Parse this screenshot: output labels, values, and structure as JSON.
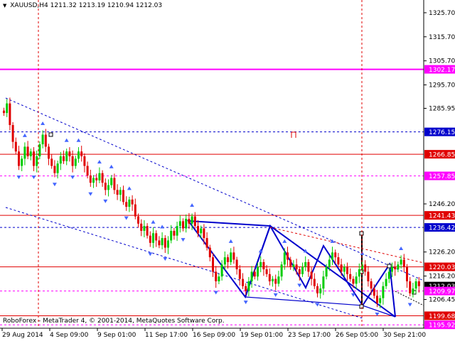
{
  "header": {
    "symbol": "XAUUSD,H4",
    "open": "1211.32",
    "high": "1213.19",
    "low": "1210.94",
    "close": "1212.03"
  },
  "copyright": "RoboForex - MetaTrader 4, © 2001-2014, MetaQuotes Software Corp.",
  "colors": {
    "bull_candle": "#00cc00",
    "bear_candle": "#e00000",
    "pivot_line": "#ff00ff",
    "level_line": "#e00000",
    "channel": "#0000cc",
    "accent_label": "#e00000"
  },
  "icons": {
    "symbol_arrow": "triangle-down-icon",
    "alert": "alert-marker-icon"
  },
  "chart_data": {
    "type": "candlestick",
    "symbol": "XAUUSD",
    "timeframe": "H4",
    "ylim": [
      1194.5,
      1331.0
    ],
    "y_ticks": [
      "1325.70",
      "1315.70",
      "1305.70",
      "1295.70",
      "1285.95",
      "1246.20",
      "1226.20",
      "1216.20",
      "1206.45"
    ],
    "x_ticks": [
      "29 Aug 2014",
      "4 Sep 09:00",
      "9 Sep 01:00",
      "11 Sep 17:00",
      "16 Sep 09:00",
      "19 Sep 01:00",
      "23 Sep 17:00",
      "26 Sep 05:00",
      "30 Sep 21:00"
    ],
    "price_levels": [
      {
        "price": 1302.17,
        "label": "1302.17",
        "color": "#ff00ff",
        "style": "solid"
      },
      {
        "price": 1276.15,
        "label": "1276.15",
        "color": "#0000cc",
        "style": "dashed"
      },
      {
        "price": 1266.85,
        "label": "1266.85",
        "color": "#e00000",
        "style": "solid"
      },
      {
        "price": 1257.85,
        "label": "1257.85",
        "color": "#ff00ff",
        "style": "dashed"
      },
      {
        "price": 1241.43,
        "label": "1241.43",
        "color": "#e00000",
        "style": "solid"
      },
      {
        "price": 1236.42,
        "label": "1236.42",
        "color": "#0000cc",
        "style": "dashed"
      },
      {
        "price": 1220.03,
        "label": "1220.03",
        "color": "#e00000",
        "style": "solid"
      },
      {
        "price": 1212.03,
        "label": "1212.03",
        "color": "#000000",
        "style": "current"
      },
      {
        "price": 1209.97,
        "label": "1209.97",
        "color": "#ff00ff",
        "style": "dashed"
      },
      {
        "price": 1199.68,
        "label": "1199.68",
        "color": "#e00000",
        "style": "solid"
      },
      {
        "price": 1195.92,
        "label": "1195.92",
        "color": "#ff00ff",
        "style": "dashed"
      }
    ],
    "closes": [
      1284,
      1288,
      1279,
      1272,
      1268,
      1262,
      1265,
      1270,
      1266,
      1268,
      1262,
      1266,
      1271,
      1275,
      1270,
      1265,
      1262,
      1259,
      1263,
      1266,
      1264,
      1268,
      1266,
      1262,
      1265,
      1268,
      1266,
      1262,
      1258,
      1255,
      1257,
      1256,
      1259,
      1255,
      1252,
      1254,
      1257,
      1252,
      1250,
      1252,
      1247,
      1245,
      1248,
      1246,
      1241,
      1238,
      1235,
      1237,
      1233,
      1230,
      1234,
      1231,
      1229,
      1232,
      1228,
      1231,
      1235,
      1233,
      1237,
      1239,
      1236,
      1240,
      1238,
      1241,
      1237,
      1234,
      1236,
      1232,
      1228,
      1224,
      1218,
      1214,
      1216,
      1221,
      1224,
      1222,
      1226,
      1223,
      1219,
      1215,
      1212,
      1210,
      1214,
      1218,
      1216,
      1220,
      1222,
      1219,
      1217,
      1214,
      1215,
      1213,
      1216,
      1221,
      1226,
      1223,
      1220,
      1221,
      1219,
      1217,
      1220,
      1222,
      1218,
      1215,
      1212,
      1209,
      1211,
      1216,
      1220,
      1223,
      1226,
      1224,
      1221,
      1218,
      1220,
      1217,
      1215,
      1213,
      1216,
      1219,
      1221,
      1218,
      1214,
      1211,
      1208,
      1205,
      1207,
      1212,
      1215,
      1218,
      1220,
      1219,
      1221,
      1223,
      1220,
      1214,
      1209,
      1211,
      1214,
      1212
    ]
  }
}
